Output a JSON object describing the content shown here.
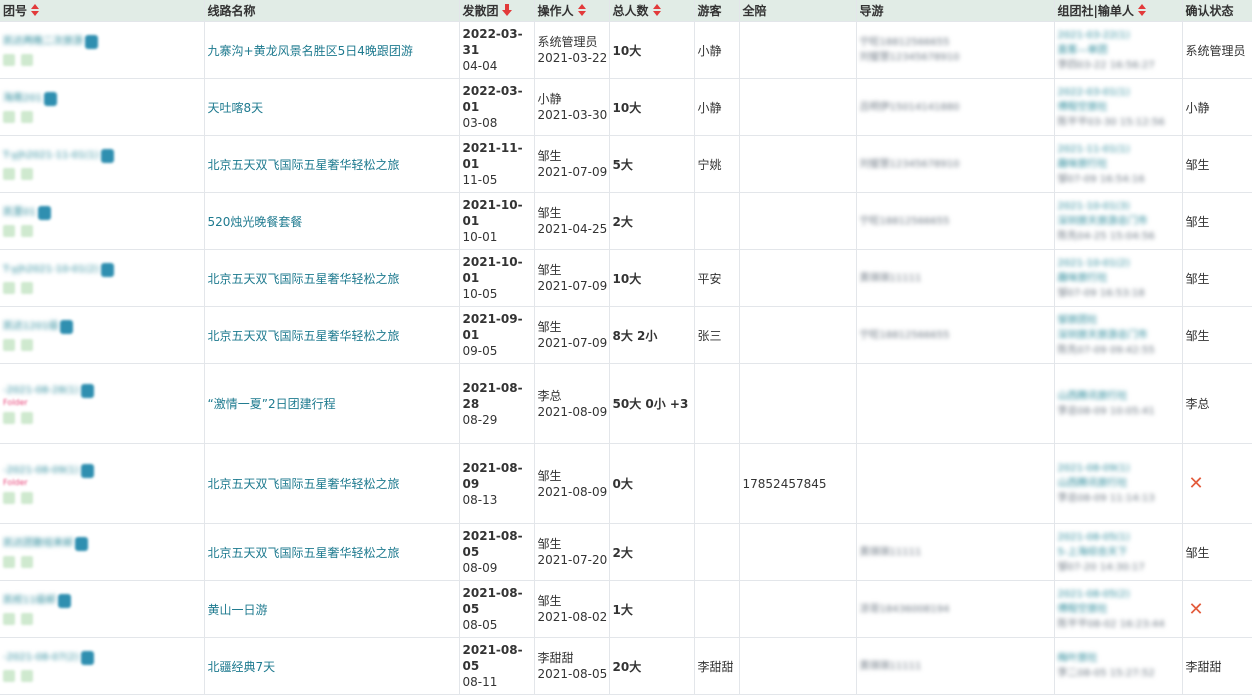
{
  "headers": {
    "team_no": "团号",
    "route_name": "线路名称",
    "depart": "发散团",
    "operator": "操作人",
    "total": "总人数",
    "tourist": "游客",
    "escort": "全陪",
    "guide": "导游",
    "agency": "组团社|输单人",
    "confirm": "确认状态"
  },
  "rows": [
    {
      "code": "凯达两晚二次旅游",
      "route": "九寨沟+黄龙风景名胜区5日4晚跟团游",
      "date": "2022-03-31",
      "date2": "04-04",
      "op": "系统管理员",
      "op_date": "2021-03-22",
      "total": "10大",
      "tourist": "小静",
      "escort": "",
      "guide1": "宁旺18812566655",
      "guide2": "刘璧慧12345678910",
      "ag1": "2021-03-22(1)",
      "ag2": "直客—单团",
      "ag3": "李四03-22 16:56:27",
      "status": "系统管理员",
      "status_x": false,
      "pink": ""
    },
    {
      "code": "海南201",
      "route": "天吐喀8天",
      "date": "2022-03-01",
      "date2": "03-08",
      "op": "小静",
      "op_date": "2021-03-30",
      "total": "10大",
      "tourist": "小静",
      "escort": "",
      "guide1": "吕明伊15014141880",
      "guide2": "",
      "ag1": "2022-03-01(1)",
      "ag2": "傅程空旅社",
      "ag3": "陈平平03-30 15:12:56",
      "status": "小静",
      "status_x": false,
      "pink": ""
    },
    {
      "code": "T-yjh2021-11-01(1)",
      "route": "北京五天双飞国际五星奢华轻松之旅",
      "date": "2021-11-01",
      "date2": "11-05",
      "op": "邹生",
      "op_date": "2021-07-09",
      "total": "5大",
      "tourist": "宁姚",
      "escort": "",
      "guide1": "刘璧慧12345678910",
      "guide2": "",
      "ag1": "2021-11-01(1)",
      "ag2": "趣味旅行社",
      "ag3": "邹07-09 16:54:16",
      "status": "邹生",
      "status_x": false,
      "pink": ""
    },
    {
      "code": "凯里01",
      "route": "520烛光晚餐套餐",
      "date": "2021-10-01",
      "date2": "10-01",
      "op": "邹生",
      "op_date": "2021-04-25",
      "total": "2大",
      "tourist": "",
      "escort": "",
      "guide1": "宁旺18812566655",
      "guide2": "",
      "ag1": "2021-10-01(3)",
      "ag2": "深圳旅天旅游总门市",
      "ag3": "陈先04-25 15:04:56",
      "status": "邹生",
      "status_x": false,
      "pink": ""
    },
    {
      "code": "T-yjh2021-10-01(2)",
      "route": "北京五天双飞国际五星奢华轻松之旅",
      "date": "2021-10-01",
      "date2": "10-05",
      "op": "邹生",
      "op_date": "2021-07-09",
      "total": "10大",
      "tourist": "平安",
      "escort": "",
      "guide1": "黄琪琪11111",
      "guide2": "",
      "ag1": "2021-10-01(2)",
      "ag2": "趣味旅行社",
      "ag3": "邹07-09 16:53:18",
      "status": "邹生",
      "status_x": false,
      "pink": ""
    },
    {
      "code": "凯达1201级",
      "route": "北京五天双飞国际五星奢华轻松之旅",
      "date": "2021-09-01",
      "date2": "09-05",
      "op": "邹生",
      "op_date": "2021-07-09",
      "total": "8大 2小",
      "tourist": "张三",
      "escort": "",
      "guide1": "宁旺18812566655",
      "guide2": "",
      "ag1": "邹旅团社",
      "ag2": "深圳旅天旅游总门市",
      "ag3": "陈先07-09 09:42:55",
      "status": "邹生",
      "status_x": false,
      "pink": ""
    },
    {
      "code": "-2021-08-28(1)",
      "route": "“激情一夏”2日团建行程",
      "date": "2021-08-28",
      "date2": "08-29",
      "op": "李总",
      "op_date": "2021-08-09",
      "total": "50大 0小 +3",
      "tourist": "",
      "escort": "",
      "guide1": "",
      "guide2": "",
      "ag1": "",
      "ag2": "山西腾讯旅行社",
      "ag3": "李总08-09 10:05:41",
      "status": "李总",
      "status_x": false,
      "pink": "Folder"
    },
    {
      "code": "-2021-08-09(1)",
      "route": "北京五天双飞国际五星奢华轻松之旅",
      "date": "2021-08-09",
      "date2": "08-13",
      "op": "邹生",
      "op_date": "2021-08-09",
      "total": "0大",
      "tourist": "",
      "escort": "17852457845",
      "guide1": "",
      "guide2": "",
      "ag1": "2021-08-09(1)",
      "ag2": "山西腾讯旅行社",
      "ag3": "李总08-09 11:14:13",
      "status": "",
      "status_x": true,
      "pink": "Folder"
    },
    {
      "code": "凯达团散组来邮",
      "route": "北京五天双飞国际五星奢华轻松之旅",
      "date": "2021-08-05",
      "date2": "08-09",
      "op": "邹生",
      "op_date": "2021-07-20",
      "total": "2大",
      "tourist": "",
      "escort": "",
      "guide1": "黄琪琪11111",
      "guide2": "",
      "ag1": "2021-08-05(1)",
      "ag2": "5-上海综合天下",
      "ag3": "邹07-20 14:30:17",
      "status": "邹生",
      "status_x": false,
      "pink": ""
    },
    {
      "code": "凯校11级邮",
      "route": "黄山一日游",
      "date": "2021-08-05",
      "date2": "08-05",
      "op": "邹生",
      "op_date": "2021-08-02",
      "total": "1大",
      "tourist": "",
      "escort": "",
      "guide1": "凉哥18436008194",
      "guide2": "",
      "ag1": "2021-08-05(2)",
      "ag2": "傅程空旅社",
      "ag3": "陈平平08-02 16:23:44",
      "status": "",
      "status_x": true,
      "pink": ""
    },
    {
      "code": "-2021-08-07(2)",
      "route": "北疆经典7天",
      "date": "2021-08-05",
      "date2": "08-11",
      "op": "李甜甜",
      "op_date": "2021-08-05",
      "total": "20大",
      "tourist": "李甜甜",
      "escort": "",
      "guide1": "黄琪琪11111",
      "guide2": "",
      "ag1": "梅叶旅社",
      "ag2": "",
      "ag3": "李二08-05 15:27:52",
      "status": "李甜甜",
      "status_x": false,
      "pink": ""
    }
  ]
}
